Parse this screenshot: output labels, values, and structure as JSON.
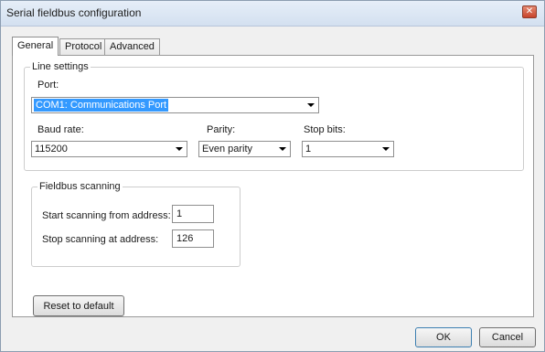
{
  "window": {
    "title": "Serial fieldbus configuration",
    "close_symbol": "✕"
  },
  "tabs": [
    {
      "label": "General",
      "active": true
    },
    {
      "label": "Protocol",
      "active": false
    },
    {
      "label": "Advanced",
      "active": false
    }
  ],
  "line_settings": {
    "legend": "Line settings",
    "port_label": "Port:",
    "port_value": "COM1: Communications Port",
    "baud_label": "Baud rate:",
    "baud_value": "115200",
    "parity_label": "Parity:",
    "parity_value": "Even parity",
    "stopbits_label": "Stop bits:",
    "stopbits_value": "1"
  },
  "fieldbus_scanning": {
    "legend": "Fieldbus scanning",
    "start_label": "Start scanning from address:",
    "start_value": "1",
    "stop_label": "Stop scanning at address:",
    "stop_value": "126"
  },
  "buttons": {
    "reset": "Reset to default",
    "ok": "OK",
    "cancel": "Cancel"
  },
  "icons": {
    "close": "close-icon",
    "dropdown": "chevron-down-icon"
  },
  "colors": {
    "selection": "#3399ff",
    "close_button": "#c8432b"
  }
}
